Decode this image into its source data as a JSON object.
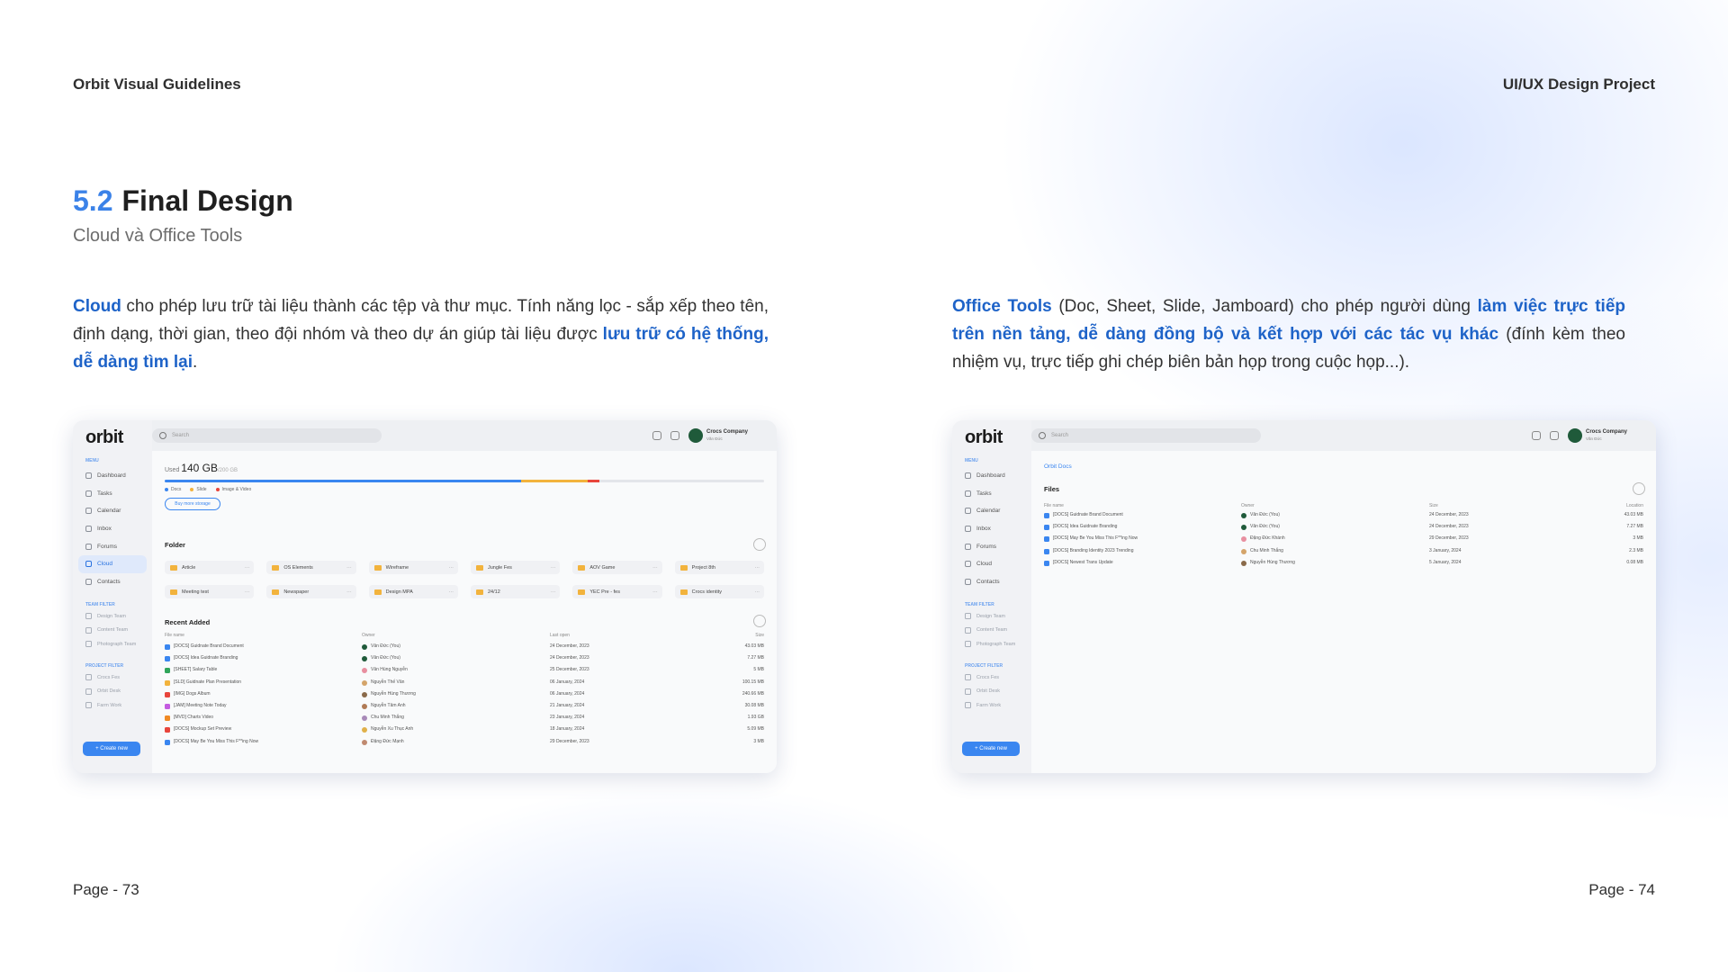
{
  "header": {
    "left": "Orbit Visual Guidelines",
    "right": "UI/UX Design Project"
  },
  "section": {
    "number": "5.2",
    "title": "Final Design",
    "subtitle": "Cloud và Office Tools"
  },
  "left_desc": {
    "h1": "Cloud",
    "t1": " cho phép lưu trữ tài liệu thành các tệp và thư mục. Tính năng lọc - sắp xếp theo tên, định dạng, thời gian, theo đội nhóm và theo dự án giúp tài liệu được ",
    "h2": "lưu trữ có hệ thống, dễ dàng tìm lại",
    "t2": "."
  },
  "right_desc": {
    "h1": "Office Tools",
    "t1": " (Doc, Sheet, Slide, Jamboard) cho phép người dùng ",
    "h2": "làm việc trực tiếp trên nền tảng, dễ dàng đồng bộ và kết hợp với các tác vụ khác",
    "t2": " (đính kèm theo nhiệm vụ, trực tiếp ghi chép biên bản họp trong cuộc họp...)."
  },
  "footer": {
    "left": "Page - 73",
    "right": "Page - 74"
  },
  "app": {
    "logo": "orbit",
    "menu_label": "MENU",
    "nav": [
      {
        "label": "Dashboard",
        "active": false
      },
      {
        "label": "Tasks",
        "active": false
      },
      {
        "label": "Calendar",
        "active": false
      },
      {
        "label": "Inbox",
        "active": false
      },
      {
        "label": "Forums",
        "active": false
      },
      {
        "label": "Cloud",
        "active": true
      },
      {
        "label": "Contacts",
        "active": false
      }
    ],
    "team_filter_label": "TEAM FILTER",
    "team_filters": [
      "Design Team",
      "Content Team",
      "Photograph Team"
    ],
    "project_filter_label": "PROJECT FILTER",
    "project_filters": [
      "Crocs Fes",
      "Orbit Desk",
      "Farm Work"
    ],
    "create_label": "+ Create new",
    "search_placeholder": "Search",
    "company": "Crocs Company",
    "company_sub": "Văn Đức",
    "colors": {
      "accent": "#3a86f0",
      "highlight": "#1e63c8",
      "section_num": "#3b82e8"
    }
  },
  "cloud": {
    "used_label": "Used",
    "used_value": "140 GB",
    "total": "/200 GB",
    "usage": {
      "docs": 0.595,
      "slide": 0.11,
      "image_video": 0.02
    },
    "legend": [
      "Docs",
      "Slide",
      "Image & Video"
    ],
    "buy_more": "Buy more storage",
    "folder_title": "Folder",
    "folders": [
      "Article",
      "OS Elements",
      "Wireframe",
      "Jungle Fes",
      "AOV Game",
      "Project 8th",
      "Meeting test",
      "Newspaper",
      "Design MPA",
      "24/12",
      "YEC Pre - fes",
      "Crocs identity"
    ],
    "recent_title": "Recent Added",
    "columns": [
      "File name",
      "Owner",
      "Last open",
      "Size"
    ],
    "rows": [
      {
        "name": "[DOCS] Guidnate Brand Document",
        "owner": "Văn Đức (You)",
        "date": "24 December, 2023",
        "size": "43.03 MB",
        "type": "doc"
      },
      {
        "name": "[DOCS] Idea Guidnate Branding",
        "owner": "Văn Đức (You)",
        "date": "24 December, 2023",
        "size": "7.27 MB",
        "type": "doc"
      },
      {
        "name": "[SHEET] Salary Table",
        "owner": "Văn Hùng Nguyễn",
        "date": "25 December, 2023",
        "size": "5 MB",
        "type": "sheet"
      },
      {
        "name": "[SLD] Guidnate Plan Presentation",
        "owner": "Nguyễn Thế Vân",
        "date": "06 January, 2024",
        "size": "100.15 MB",
        "type": "slide"
      },
      {
        "name": "[IMG] Dogs Album",
        "owner": "Nguyễn Hùng Thương",
        "date": "06 January, 2024",
        "size": "240.66 MB",
        "type": "img"
      },
      {
        "name": "[JAM] Meeting Note Today",
        "owner": "Nguyễn Tâm Anh",
        "date": "21 January, 2024",
        "size": "30.08 MB",
        "type": "jam"
      },
      {
        "name": "[MVD] Charts Video",
        "owner": "Chu Minh Thắng",
        "date": "23 January, 2024",
        "size": "1.93 GB",
        "type": "video"
      },
      {
        "name": "[DOCS] Mockup Set Preview",
        "owner": "Nguyễn Xu Thục Anh",
        "date": "18 January, 2024",
        "size": "5.09 MB",
        "type": "doc2"
      },
      {
        "name": "[DOCS] May Be You Miss This F**ing Now",
        "owner": "Đặng Đức Mạnh",
        "date": "29 December, 2023",
        "size": "3 MB",
        "type": "doc"
      }
    ]
  },
  "docs": {
    "breadcrumb": "Orbit Docs",
    "title": "Files",
    "columns": [
      "File name",
      "Owner",
      "Size",
      "Location"
    ],
    "rows": [
      {
        "name": "[DOCS] Guidnate Brand Document",
        "owner": "Văn Đức (You)",
        "date": "24 December, 2023",
        "size": "43.03 MB"
      },
      {
        "name": "[DOCS] Idea Guidnate Branding",
        "owner": "Văn Đức (You)",
        "date": "24 December, 2023",
        "size": "7.27 MB"
      },
      {
        "name": "[DOCS] May Be You Miss This F**ing Now",
        "owner": "Đặng Đức Khánh",
        "date": "29 December, 2023",
        "size": "3 MB"
      },
      {
        "name": "[DOCS] Branding Identity 2023 Trending",
        "owner": "Chu Minh Thắng",
        "date": "3 January, 2024",
        "size": "2.3 MB"
      },
      {
        "name": "[DOCS] Newest Trans Update",
        "owner": "Nguyễn Hùng Thương",
        "date": "5 January, 2024",
        "size": "0.08 MB"
      }
    ]
  }
}
